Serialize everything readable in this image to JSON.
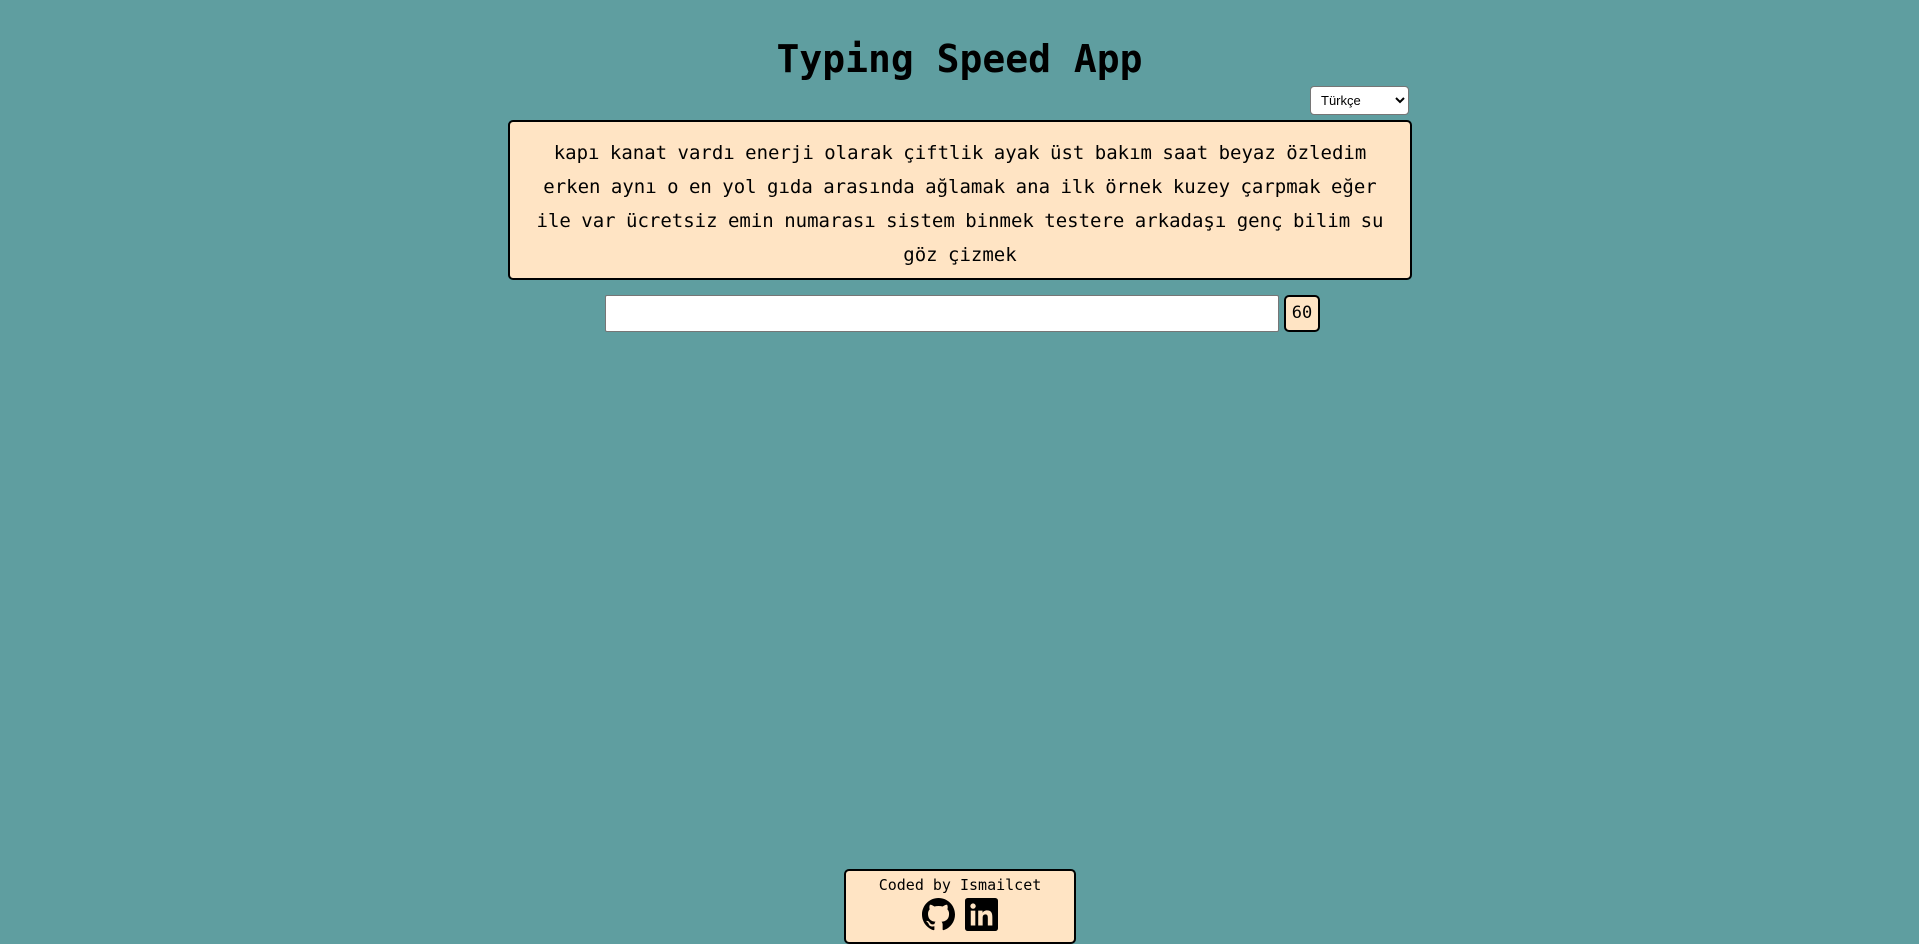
{
  "app": {
    "title": "Typing Speed App"
  },
  "language_select": {
    "selected": "Türkçe",
    "options": [
      "Türkçe"
    ]
  },
  "words_text": "kapı kanat vardı enerji olarak çiftlik ayak üst bakım saat beyaz özledim erken aynı o en yol gıda arasında ağlamak ana ilk örnek kuzey çarpmak eğer ile var ücretsiz emin numarası sistem binmek testere arkadaşı genç bilim su göz çizmek",
  "typing_input": {
    "value": "",
    "placeholder": ""
  },
  "timer": "60",
  "footer": {
    "credit": "Coded by Ismailcet",
    "icons": [
      "github-icon",
      "linkedin-icon"
    ]
  },
  "colors": {
    "background": "#5f9ea0",
    "panel": "#ffe4c4",
    "border": "#000000"
  }
}
